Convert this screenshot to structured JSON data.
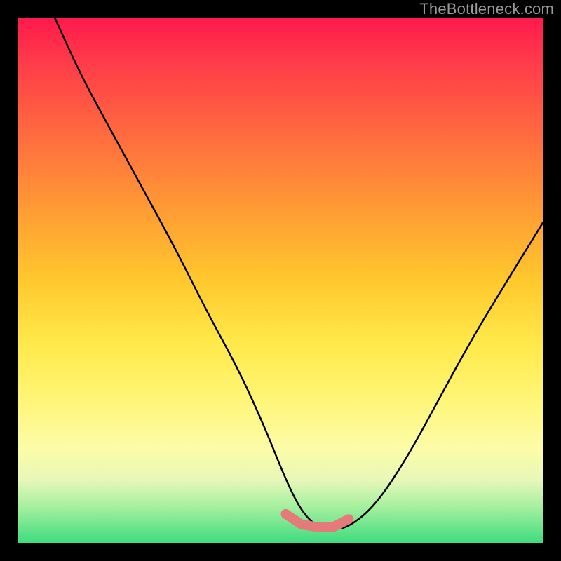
{
  "watermark": "TheBottleneck.com",
  "colors": {
    "page_bg": "#000000",
    "gradient_top": "#ff1a4b",
    "gradient_mid1": "#ff9a35",
    "gradient_mid2": "#ffe94a",
    "gradient_bottom": "#3fdc7e",
    "curve": "#000000",
    "highlight": "#e47a7a",
    "watermark": "#9a9a9a"
  },
  "chart_data": {
    "type": "line",
    "title": "",
    "xlabel": "",
    "ylabel": "",
    "xlim": [
      0,
      100
    ],
    "ylim": [
      0,
      100
    ],
    "grid": false,
    "legend": false,
    "series": [
      {
        "name": "curve",
        "x": [
          7,
          12,
          18,
          24,
          30,
          36,
          42,
          47,
          51,
          54,
          57,
          60,
          63,
          68,
          74,
          80,
          86,
          92,
          100
        ],
        "y": [
          100,
          89,
          78,
          67,
          56,
          44,
          33,
          22,
          12,
          6,
          3,
          2.5,
          3,
          7,
          16,
          27,
          38,
          48,
          61
        ]
      }
    ],
    "highlight_segment": {
      "x": [
        51,
        54,
        57,
        60,
        63
      ],
      "y": [
        5.5,
        3.5,
        3,
        3,
        4.5
      ]
    }
  }
}
